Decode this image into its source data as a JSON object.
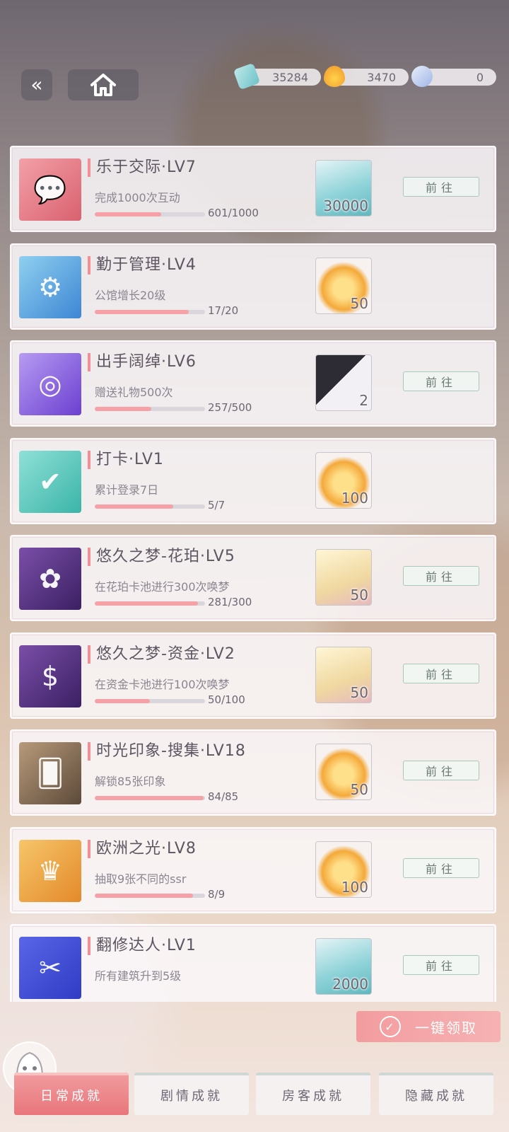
{
  "currencies": [
    {
      "icon": "banknote-icon",
      "value": "35284"
    },
    {
      "icon": "amber-gem-icon",
      "value": "3470"
    },
    {
      "icon": "crystal-icon",
      "value": "0"
    }
  ],
  "achievements": [
    {
      "title": "乐于交际·LV7",
      "desc": "完成1000次互动",
      "progress": "601/1000",
      "fraction": 0.601,
      "reward_icon": "banknote-icon",
      "reward_amount": "30000",
      "go_label": "前往",
      "badge_icon": "chat-bubbles-icon"
    },
    {
      "title": "勤于管理·LV4",
      "desc": "公馆增长20级",
      "progress": "17/20",
      "fraction": 0.85,
      "reward_icon": "amber-gem-icon",
      "reward_amount": "50",
      "go_label": "",
      "badge_icon": "gear-emblem-icon"
    },
    {
      "title": "出手阔绰·LV6",
      "desc": "赠送礼物500次",
      "progress": "257/500",
      "fraction": 0.514,
      "reward_icon": "cat-card-icon",
      "reward_amount": "2",
      "go_label": "前往",
      "badge_icon": "coin-ring-icon"
    },
    {
      "title": "打卡·LV1",
      "desc": "累计登录7日",
      "progress": "5/7",
      "fraction": 0.714,
      "reward_icon": "amber-gem-icon",
      "reward_amount": "100",
      "go_label": "",
      "badge_icon": "calendar-check-icon"
    },
    {
      "title": "悠久之梦-花珀·LV5",
      "desc": "在花珀卡池进行300次唤梦",
      "progress": "281/300",
      "fraction": 0.937,
      "reward_icon": "flower-tag-icon",
      "reward_amount": "50",
      "go_label": "前往",
      "badge_icon": "flower-crest-icon"
    },
    {
      "title": "悠久之梦-资金·LV2",
      "desc": "在资金卡池进行100次唤梦",
      "progress": "50/100",
      "fraction": 0.5,
      "reward_icon": "flower-tag-icon",
      "reward_amount": "50",
      "go_label": "前往",
      "badge_icon": "dollar-crest-icon"
    },
    {
      "title": "时光印象-搜集·LV18",
      "desc": "解锁85张印象",
      "progress": "84/85",
      "fraction": 0.988,
      "reward_icon": "amber-gem-icon",
      "reward_amount": "50",
      "go_label": "前往",
      "badge_icon": "cards-lock-icon"
    },
    {
      "title": "欧洲之光·LV8",
      "desc": "抽取9张不同的ssr",
      "progress": "8/9",
      "fraction": 0.889,
      "reward_icon": "amber-gem-icon",
      "reward_amount": "100",
      "go_label": "前往",
      "badge_icon": "crown-icon"
    },
    {
      "title": "翻修达人·LV1",
      "desc": "所有建筑升到5级",
      "progress": "",
      "fraction": 0,
      "reward_icon": "banknote-icon",
      "reward_amount": "2000",
      "go_label": "前往",
      "badge_icon": "tools-icon"
    }
  ],
  "claim_all_label": "一键领取",
  "tabs": [
    {
      "label": "日常成就",
      "active": true
    },
    {
      "label": "剧情成就",
      "active": false
    },
    {
      "label": "房客成就",
      "active": false
    },
    {
      "label": "隐藏成就",
      "active": false
    }
  ]
}
